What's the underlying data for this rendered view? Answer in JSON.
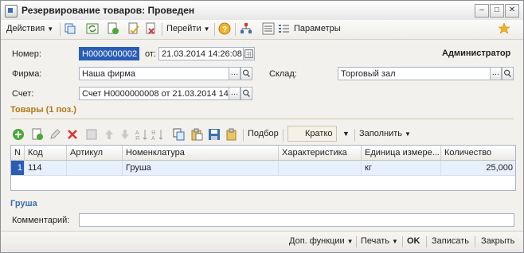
{
  "window": {
    "title": "Резервирование товаров: Проведен"
  },
  "toolbar": {
    "actions_label": "Действия",
    "goto_label": "Перейти",
    "params_label": "Параметры",
    "icons": [
      "copy-icon",
      "refresh-icon",
      "new-doc-icon",
      "post-icon",
      "unpost-icon",
      "help-icon",
      "structure-icon",
      "list-icon",
      "settings-list-icon",
      "star-icon"
    ]
  },
  "header": {
    "user": "Администратор"
  },
  "form": {
    "number_label": "Номер:",
    "number_value": "Н0000000002",
    "date_label": "от:",
    "date_value": "21.03.2014 14:26:08",
    "firm_label": "Фирма:",
    "firm_value": "Наша фирма",
    "warehouse_label": "Склад:",
    "warehouse_value": "Торговый зал",
    "invoice_label": "Счет:",
    "invoice_value": "Счет Н0000000008 от 21.03.2014 14:26:08"
  },
  "goods": {
    "section_title": "Товары (1 поз.)",
    "selection_label": "Подбор",
    "brief_label": "Кратко",
    "fill_label": "Заполнить",
    "columns": [
      "N",
      "Код",
      "Артикул",
      "Номенклатура",
      "Характеристика",
      "Единица измере...",
      "Количество"
    ],
    "rows": [
      {
        "n": "1",
        "code": "114",
        "article": "",
        "name": "Груша",
        "char": "",
        "unit": "кг",
        "qty": "25,000"
      }
    ]
  },
  "selected_item": "Груша",
  "comment": {
    "label": "Комментарий:",
    "value": ""
  },
  "footer": {
    "extra_label": "Доп. функции",
    "print_label": "Печать",
    "ok_label": "OK",
    "save_label": "Записать",
    "close_label": "Закрыть"
  },
  "colors": {
    "accent": "#b07a17",
    "selection": "#2a5db6",
    "link": "#3a6fb0"
  }
}
